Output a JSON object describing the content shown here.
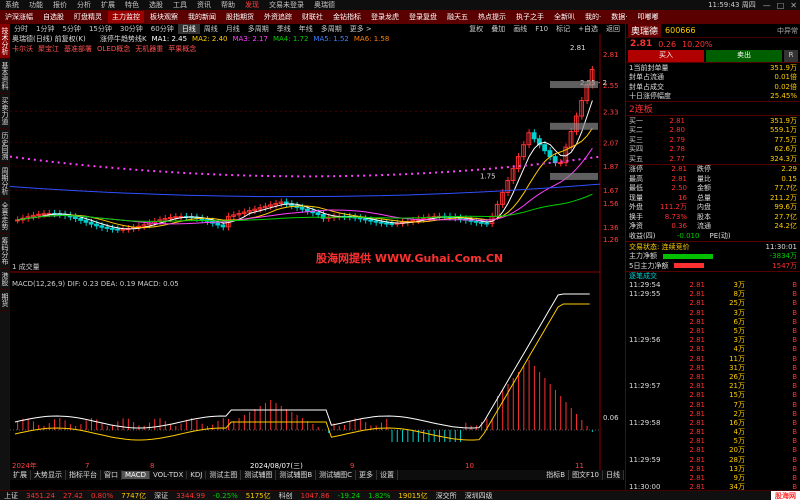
{
  "menu": {
    "items": [
      "系统",
      "功能",
      "报价",
      "分析",
      "扩展",
      "特色",
      "选股",
      "工具",
      "资讯",
      "帮助"
    ],
    "highlight": "发现",
    "center": [
      "交易未登录",
      "奥瑞德"
    ],
    "clock": "11:59:43 周四",
    "window_controls": [
      "—",
      "□",
      "✕"
    ]
  },
  "toolbar": {
    "buttons": [
      "沪深涨幅",
      "自选股",
      "盯盘精灵",
      "主力监控",
      "板块观察",
      "我的新闻",
      "股指期货",
      "外资追踪",
      "财联社",
      "金钻指标",
      "登录龙虎",
      "登录复盘",
      "融天五",
      "热点提示",
      "执子之手",
      "全新叭",
      "我的·",
      "数据·",
      "叩嘟嘟"
    ],
    "selected_index": 3
  },
  "left_strip": [
    "技术分析",
    "基本资料",
    "买卖力道",
    "历史回溯",
    "周期分析",
    "全景走势",
    "筹码分布",
    "港股",
    "期货"
  ],
  "period_bar": {
    "items": [
      "分时",
      "1分钟",
      "5分钟",
      "15分钟",
      "30分钟",
      "60分钟",
      "日线",
      "周线",
      "月线",
      "多周期",
      "季线",
      "年线",
      "多周期",
      "更多 >"
    ],
    "active_index": 6,
    "right": [
      "复权",
      "叠加",
      "画线",
      "F10",
      "标记",
      "+自选",
      "返回"
    ]
  },
  "chart": {
    "title_line": "奥瑞德(日线)  前复权(K)",
    "ma_line": [
      "涨停牛趋势线K",
      "MA1: 2.45",
      "MA2: 2.40",
      "MA3: 2.17",
      "MA4: 1.72",
      "MA5: 1.52",
      "MA6: 1.58"
    ],
    "tags": [
      "卡尔沃",
      "聚宝江",
      "基准部署",
      "OLED概念",
      "无机器重",
      "苹果概念"
    ],
    "price_labels": [
      "2.81",
      "2.55",
      "2.33",
      "2.07",
      "1.87",
      "1.67",
      "1.56",
      "1.36",
      "1.26"
    ],
    "annotations": [
      "2.81",
      "1.75",
      "2.55 - 2"
    ],
    "watermark": "股海网提供  WWW.Guhai.Com.CN",
    "macd_label": "MACD(12,26,9)  DIF: 0.23  DEA: 0.19  MACD: 0.05",
    "macd_axis": [
      "0.06"
    ],
    "date_labels": [
      "2024年",
      "7",
      "8",
      "2024/08/07(三)",
      "9",
      "10",
      "11"
    ],
    "volume_label": "1   成交量"
  },
  "chart_data": {
    "type": "candlestick",
    "title": "奥瑞德(日线)",
    "y_range": [
      1.26,
      2.81
    ],
    "last_close": 2.81,
    "macd": {
      "dif": 0.23,
      "dea": 0.19,
      "macd": 0.05
    }
  },
  "bottom_tabs": [
    "扩展",
    "大势显示",
    "指标平台",
    "窗口",
    "MACD",
    "VOL-TDX",
    "KDJ",
    "测试主图",
    "测试辅图",
    "测试辅图B",
    "测试辅图C",
    "更多",
    "设置"
  ],
  "bottom_right": [
    "指标B",
    "图文F10",
    "日线"
  ],
  "right_panel": {
    "name": "奥瑞德",
    "code": "600666",
    "price": "2.81",
    "change": "0.26",
    "pct": "10.20%",
    "tag": "中异常",
    "buttons": [
      "买入",
      "卖出",
      "R"
    ],
    "board_info": [
      {
        "k": "1当前封单量",
        "v": "351.9万"
      },
      {
        "k": "封单占流通",
        "v": "0.01倍"
      },
      {
        "k": "封单占成交",
        "v": "0.02倍"
      },
      {
        "k": "十日涨停幅度",
        "v": "25.45%"
      }
    ],
    "board_title": "2连板",
    "order_book": [
      {
        "k": "买一",
        "p": "2.81",
        "q": "351.9万"
      },
      {
        "k": "买二",
        "p": "2.80",
        "q": "559.1万"
      },
      {
        "k": "买三",
        "p": "2.79",
        "q": "77.5万"
      },
      {
        "k": "买四",
        "p": "2.78",
        "q": "62.6万"
      },
      {
        "k": "买五",
        "p": "2.77",
        "q": "324.3万"
      }
    ],
    "quote": [
      [
        "涨停",
        "2.81",
        "跌停",
        "2.29"
      ],
      [
        "最高",
        "2.81",
        "量比",
        "0.15"
      ],
      [
        "最低",
        "2.50",
        "金额",
        "77.7亿"
      ],
      [
        "现量",
        "16",
        "总量",
        "211.2万"
      ],
      [
        "外盘",
        "111.2万",
        "内盘",
        "99.6万"
      ],
      [
        "换手",
        "8.73%",
        "股本",
        "27.7亿"
      ],
      [
        "净资",
        "0.36",
        "流通",
        "24.2亿"
      ],
      [
        "收益(四)",
        "-0.010",
        "PE(动)",
        ""
      ]
    ],
    "status": {
      "label": "交易状态: 连续竞价",
      "time": "11:30:01"
    },
    "flow": [
      {
        "k": "主力净额",
        "v": "-3834万"
      },
      {
        "k": "5日主力净额",
        "v": "1547万"
      }
    ],
    "ticks_title": "逐笔成交",
    "ticks": [
      [
        "11:29:54",
        "2.81",
        "3万",
        "B"
      ],
      [
        "11:29:55",
        "2.81",
        "8万",
        "B"
      ],
      [
        "",
        "2.81",
        "25万",
        "B"
      ],
      [
        "",
        "2.81",
        "3万",
        "B"
      ],
      [
        "",
        "2.81",
        "6万",
        "B"
      ],
      [
        "",
        "2.81",
        "5万",
        "B"
      ],
      [
        "11:29:56",
        "2.81",
        "3万",
        "B"
      ],
      [
        "",
        "2.81",
        "4万",
        "B"
      ],
      [
        "",
        "2.81",
        "11万",
        "B"
      ],
      [
        "",
        "2.81",
        "31万",
        "B"
      ],
      [
        "",
        "2.81",
        "26万",
        "B"
      ],
      [
        "11:29:57",
        "2.81",
        "21万",
        "B"
      ],
      [
        "",
        "2.81",
        "15万",
        "B"
      ],
      [
        "",
        "2.81",
        "7万",
        "B"
      ],
      [
        "",
        "2.81",
        "2万",
        "B"
      ],
      [
        "11:29:58",
        "2.81",
        "16万",
        "B"
      ],
      [
        "",
        "2.81",
        "4万",
        "B"
      ],
      [
        "",
        "2.81",
        "5万",
        "B"
      ],
      [
        "",
        "2.81",
        "20万",
        "B"
      ],
      [
        "11:29:59",
        "2.81",
        "28万",
        "B"
      ],
      [
        "",
        "2.81",
        "13万",
        "B"
      ],
      [
        "",
        "2.81",
        "9万",
        "B"
      ],
      [
        "11:30:00",
        "2.81",
        "34万",
        "B"
      ]
    ]
  },
  "status_bar": {
    "items": [
      {
        "t": "上证",
        "c": "wht"
      },
      {
        "t": "3451.24",
        "c": "red"
      },
      {
        "t": "27.42",
        "c": "red"
      },
      {
        "t": "0.80%",
        "c": "red"
      },
      {
        "t": "7747亿",
        "c": "yel"
      },
      {
        "t": "深证",
        "c": "wht"
      },
      {
        "t": "3344.99",
        "c": "red"
      },
      {
        "t": "-0.25%",
        "c": "grn"
      },
      {
        "t": "5175亿",
        "c": "yel"
      },
      {
        "t": "科创",
        "c": "wht"
      },
      {
        "t": "1047.86",
        "c": "red"
      },
      {
        "t": "-19.24",
        "c": "grn"
      },
      {
        "t": "1.82%",
        "c": "grn"
      },
      {
        "t": "19015亿",
        "c": "yel"
      },
      {
        "t": "深交所",
        "c": "wht"
      },
      {
        "t": "深圳四级",
        "c": "wht"
      }
    ],
    "brand": "股海网"
  }
}
